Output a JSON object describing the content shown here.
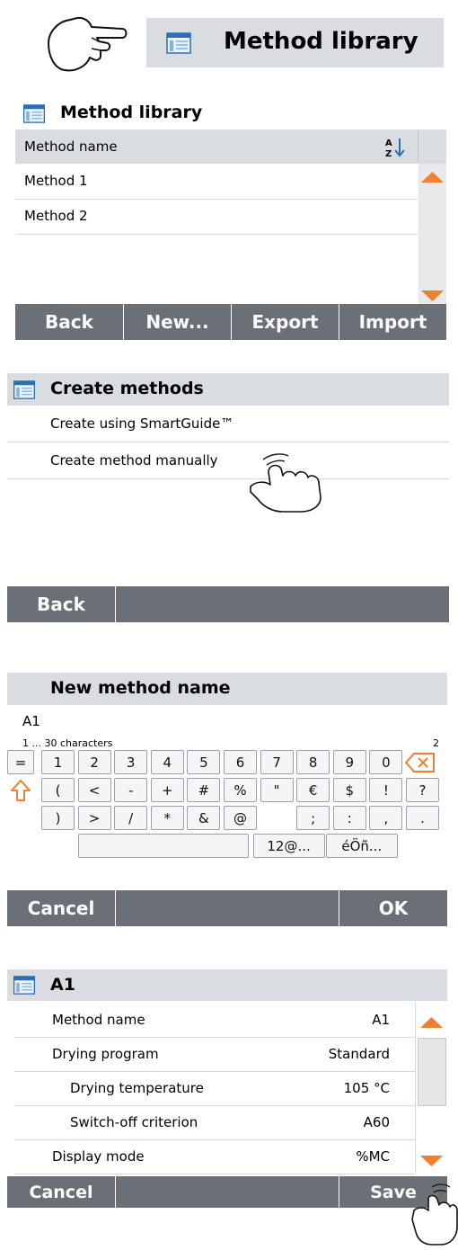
{
  "step1": {
    "button_label": "Method library"
  },
  "library": {
    "title": "Method library",
    "column_header": "Method name",
    "sort_icon_text": "A Z",
    "methods": [
      "Method 1",
      "Method 2"
    ],
    "actions": {
      "back": "Back",
      "new": "New...",
      "export": "Export",
      "import": "Import"
    }
  },
  "create": {
    "title": "Create methods",
    "options": [
      "Create using SmartGuide™",
      "Create method manually"
    ],
    "back": "Back"
  },
  "keyboard": {
    "title": "New method name",
    "value": "A1",
    "hint": "1 ... 30 characters",
    "char_count": "2",
    "row1": [
      "=",
      "1",
      "2",
      "3",
      "4",
      "5",
      "6",
      "7",
      "8",
      "9",
      "0"
    ],
    "row2": [
      "(",
      "<",
      "-",
      "+",
      "#",
      "%",
      "\"",
      "€",
      "$",
      "!",
      "?"
    ],
    "row3": [
      ")",
      ">",
      "/",
      "*",
      "&",
      "@",
      "",
      ";",
      ":",
      ",",
      "."
    ],
    "mode_numeric": "12@...",
    "mode_accents": "éÖñ...",
    "cancel": "Cancel",
    "ok": "OK"
  },
  "method": {
    "title": "A1",
    "rows": [
      {
        "label": "Method name",
        "value": "A1"
      },
      {
        "label": "Drying program",
        "value": "Standard"
      },
      {
        "label": "Drying temperature",
        "value": "105 °C"
      },
      {
        "label": "Switch-off criterion",
        "value": "A60"
      },
      {
        "label": "Display mode",
        "value": "%MC"
      }
    ],
    "cancel": "Cancel",
    "save": "Save"
  },
  "colors": {
    "accent": "#f08030",
    "title_bar": "#d9dde1",
    "action_bar": "#6a7075"
  }
}
